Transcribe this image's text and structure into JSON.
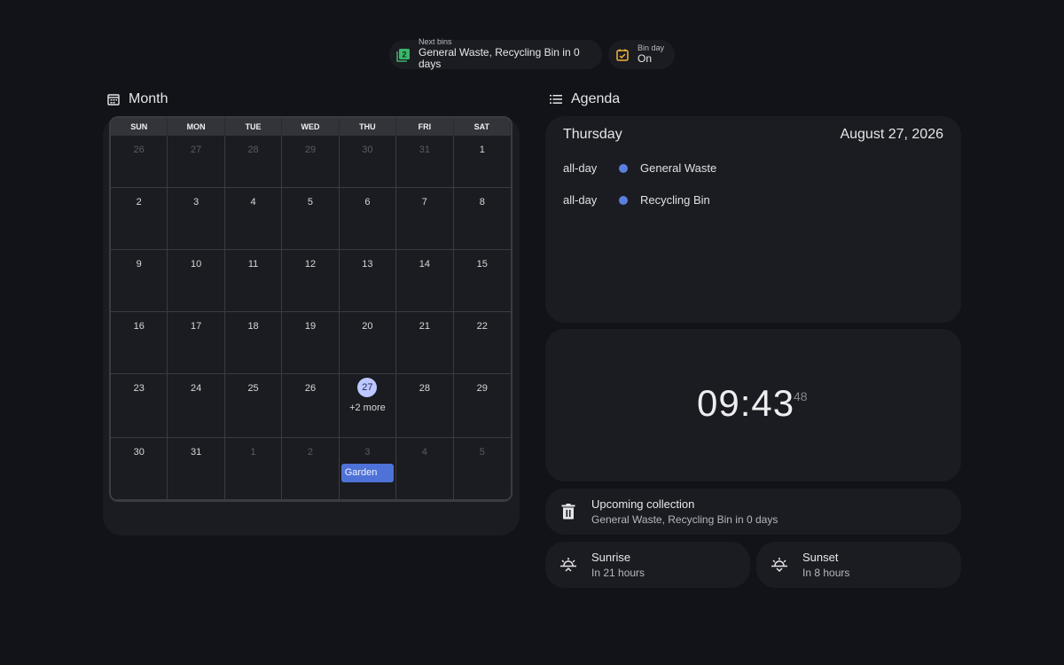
{
  "chips": {
    "next_bins": {
      "label": "Next bins",
      "value": "General Waste, Recycling Bin in 0 days",
      "icon": "bin-list-icon",
      "color": "#3bb56b"
    },
    "bin_day": {
      "label": "Bin day",
      "value": "On",
      "icon": "calendar-check-icon",
      "color": "#f2b53a"
    }
  },
  "month": {
    "title": "Month",
    "weekdays": [
      "SUN",
      "MON",
      "TUE",
      "WED",
      "THU",
      "FRI",
      "SAT"
    ],
    "days": [
      {
        "d": "26",
        "muted": true
      },
      {
        "d": "27",
        "muted": true
      },
      {
        "d": "28",
        "muted": true
      },
      {
        "d": "29",
        "muted": true
      },
      {
        "d": "30",
        "muted": true
      },
      {
        "d": "31",
        "muted": true
      },
      {
        "d": "1"
      },
      {
        "d": "2"
      },
      {
        "d": "3"
      },
      {
        "d": "4"
      },
      {
        "d": "5"
      },
      {
        "d": "6"
      },
      {
        "d": "7"
      },
      {
        "d": "8"
      },
      {
        "d": "9"
      },
      {
        "d": "10"
      },
      {
        "d": "11"
      },
      {
        "d": "12"
      },
      {
        "d": "13"
      },
      {
        "d": "14"
      },
      {
        "d": "15"
      },
      {
        "d": "16"
      },
      {
        "d": "17"
      },
      {
        "d": "18"
      },
      {
        "d": "19"
      },
      {
        "d": "20"
      },
      {
        "d": "21"
      },
      {
        "d": "22"
      },
      {
        "d": "23"
      },
      {
        "d": "24"
      },
      {
        "d": "25"
      },
      {
        "d": "26"
      },
      {
        "d": "27",
        "today": true,
        "more": "+2 more"
      },
      {
        "d": "28"
      },
      {
        "d": "29"
      },
      {
        "d": "30"
      },
      {
        "d": "31"
      },
      {
        "d": "1",
        "muted": true
      },
      {
        "d": "2",
        "muted": true
      },
      {
        "d": "3",
        "muted": true,
        "event": "Garden"
      },
      {
        "d": "4",
        "muted": true
      },
      {
        "d": "5",
        "muted": true
      }
    ]
  },
  "agenda": {
    "title": "Agenda",
    "day": "Thursday",
    "date": "August 27, 2026",
    "events": [
      {
        "time": "all-day",
        "title": "General Waste",
        "color": "#5b7fe0"
      },
      {
        "time": "all-day",
        "title": "Recycling Bin",
        "color": "#5b7fe0"
      }
    ]
  },
  "clock": {
    "time": "09:43",
    "seconds": "48"
  },
  "collection": {
    "title": "Upcoming collection",
    "subtitle": "General Waste, Recycling Bin in 0 days"
  },
  "sunrise": {
    "title": "Sunrise",
    "subtitle": "In 21 hours"
  },
  "sunset": {
    "title": "Sunset",
    "subtitle": "In 8 hours"
  }
}
